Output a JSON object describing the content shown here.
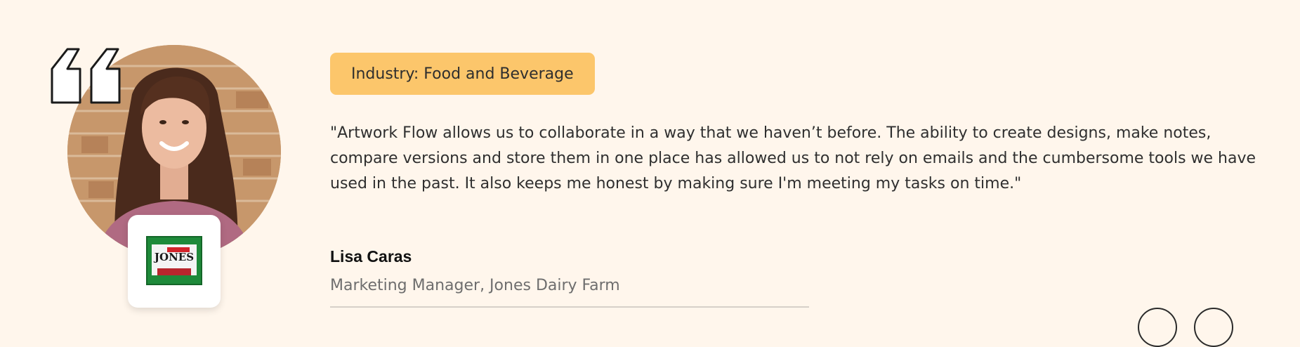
{
  "testimonial": {
    "industry_tag": "Industry: Food and Beverage",
    "quote": "\"Artwork Flow allows us to collaborate in a way that we haven’t before. The ability to create designs, make notes, compare versions and store them in one place has allowed us to not rely on emails and the cumbersome tools we have used in the past. It also keeps me honest by making sure I'm meeting my tasks on time.\"",
    "author_name": "Lisa Caras",
    "author_role": "Marketing Manager, Jones Dairy Farm"
  },
  "logo": {
    "brand_text": "JONES"
  },
  "icons": {
    "quote_mark": "quote-icon",
    "prev": "prev-arrow-icon",
    "next": "next-arrow-icon"
  },
  "colors": {
    "background": "#fff6ec",
    "tag_background": "#fcc66b",
    "text": "#2f2f2f",
    "muted_text": "#6e6e6e"
  }
}
